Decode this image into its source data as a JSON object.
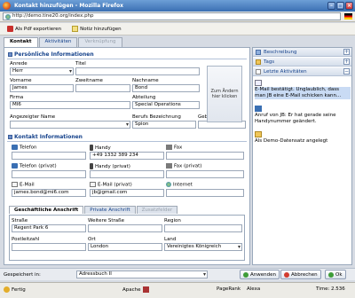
{
  "window": {
    "title": "Kontakt hinzufügen - Mozilla Firefox"
  },
  "browser": {
    "url": "http://demo.tine20.org/index.php"
  },
  "toolbar": {
    "pdf_label": "Als Pdf exportieren",
    "note_label": "Notiz hinzufügen"
  },
  "tabs": [
    {
      "label": "Kontakt"
    },
    {
      "label": "Aktivitäten"
    },
    {
      "label": "Verknüpfung"
    }
  ],
  "personal": {
    "title": "Persönliche Informationen",
    "anrede_label": "Anrede",
    "anrede_value": "Herr",
    "titel_label": "Titel",
    "titel_value": "",
    "vorname_label": "Vorname",
    "vorname_value": "James",
    "zweitname_label": "Zweitname",
    "zweitname_value": "",
    "nachname_label": "Nachname",
    "nachname_value": "Bond",
    "firma_label": "Firma",
    "firma_value": "MI6",
    "abteilung_label": "Abteilung",
    "abteilung_value": "Special Operations",
    "angezeigter_label": "Angezeigter Name",
    "angezeigter_value": "",
    "beruf_label": "Berufs Bezeichnung",
    "beruf_value": "Spion",
    "geburtstag_label": "Geburtstag",
    "geburtstag_value": "",
    "photo_label": "Zum Ändern hier klicken"
  },
  "contact": {
    "title": "Kontakt Informationen",
    "telefon_label": "Telefon",
    "telefon_value": "",
    "handy_label": "Handy",
    "handy_value": "+49 1332 389 234",
    "fax_label": "Fax",
    "fax_value": "",
    "telefon_privat_label": "Telefon (privat)",
    "telefon_privat_value": "",
    "handy_privat_label": "Handy (privat)",
    "handy_privat_value": "",
    "fax_privat_label": "Fax (privat)",
    "fax_privat_value": "",
    "email_label": "E-Mail",
    "email_value": "james.bond@mi6.com",
    "email_privat_label": "E-Mail (privat)",
    "email_privat_value": "jb@gmail.com",
    "internet_label": "Internet",
    "internet_value": ""
  },
  "address_tabs": [
    {
      "label": "Geschäftliche Anschrift"
    },
    {
      "label": "Private Anschrift"
    },
    {
      "label": "Zusatzfelder"
    }
  ],
  "address": {
    "strasse_label": "Straße",
    "strasse_value": "Regent Park 6",
    "weitere_label": "Weitere Straße",
    "weitere_value": "",
    "region_label": "Region",
    "region_value": "",
    "plz_label": "Postleitzahl",
    "plz_value": "",
    "ort_label": "Ort",
    "ort_value": "London",
    "land_label": "Land",
    "land_value": "Vereinigtes Königreich"
  },
  "sidebar": {
    "beschreibung": "Beschreibung",
    "tags": "Tags",
    "aktivitaeten": "Letzte Aktivitäten",
    "activities": [
      {
        "text": "E-Mail bestätigt. Unglaublich, dass man JB eine E-Mail schicken kann..."
      },
      {
        "text": "Anruf von JB: Er hat gerade seine Handynummer geändert."
      },
      {
        "text": "Als Demo-Datensatz angelegt"
      }
    ]
  },
  "footer": {
    "saved_in_label": "Gespeichert in:",
    "saved_in_value": "Adressbuch II",
    "apply_label": "Anwenden",
    "cancel_label": "Abbrechen",
    "ok_label": "Ok"
  },
  "status": {
    "text": "Fertig",
    "apache": "Apache",
    "pagerank": "PageRank",
    "alexa": "Alexa",
    "time": "Time: 2.536"
  }
}
